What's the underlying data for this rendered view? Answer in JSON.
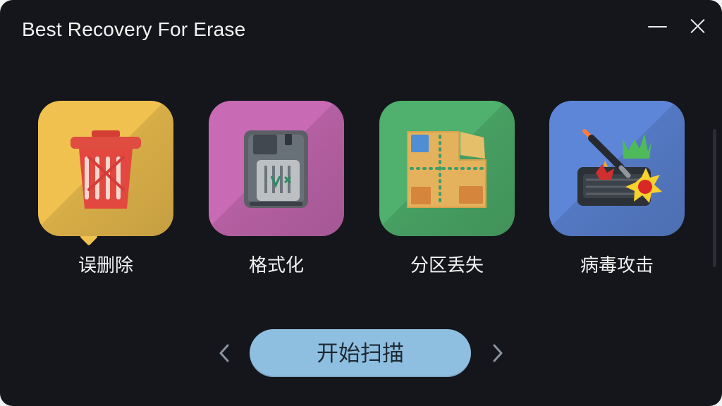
{
  "window": {
    "title": "Best Recovery For Erase"
  },
  "controls": {
    "minimize_icon": "minimize-icon",
    "close_icon": "close-icon"
  },
  "options": [
    {
      "label": "误删除",
      "icon": "trash-can-icon",
      "color": "#f0c14f"
    },
    {
      "label": "格式化",
      "icon": "storage-card-icon",
      "color": "#c96ab4"
    },
    {
      "label": "分区丢失",
      "icon": "partition-map-icon",
      "color": "#4fb16d"
    },
    {
      "label": "病毒攻击",
      "icon": "virus-attack-icon",
      "color": "#5d86d8"
    }
  ],
  "navigation": {
    "prev_icon": "chevron-left-icon",
    "next_icon": "chevron-right-icon"
  },
  "actions": {
    "start_scan_label": "开始扫描"
  },
  "colors": {
    "background": "#14161b",
    "button": "#8fbfe0",
    "text": "#f2f2f2"
  }
}
